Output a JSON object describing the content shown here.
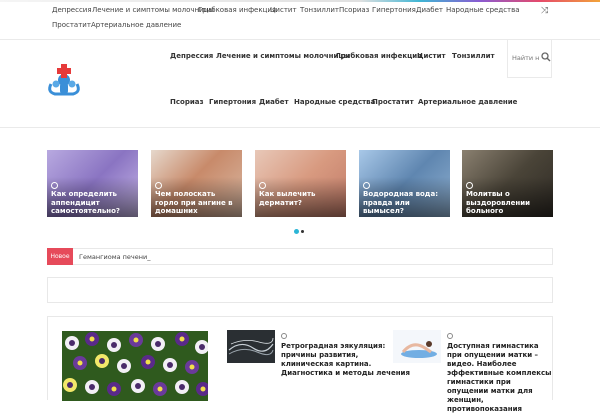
{
  "topbar": {
    "links": [
      "Депрессия",
      "Лечение и симптомы молочницы",
      "Грибковая инфекция",
      "Цистит",
      "Тонзиллит",
      "Псориаз",
      "Гипертония",
      "Диабет",
      "Народные средства",
      "Простатит",
      "Артериальное давление"
    ],
    "shuffle_icon": "shuffle-icon"
  },
  "nav": {
    "items": [
      "Депрессия",
      "Лечение и симптомы молочницы",
      "Грибковая инфекция",
      "Цистит",
      "Тонзиллит",
      "Псориаз",
      "Гипертония",
      "Диабет",
      "Народные средства",
      "Простатит",
      "Артериальное давление"
    ]
  },
  "search": {
    "placeholder": "Найти н"
  },
  "slider": {
    "slides": [
      {
        "title": "Как определить аппендицит самостоятельно?",
        "color": "#9a86c8"
      },
      {
        "title": "Чем полоскать горло при ангине в домашних условиях?",
        "color": "#c9a58a"
      },
      {
        "title": "Как вылечить дерматит?",
        "color": "#d8a088"
      },
      {
        "title": "Водородная вода: правда или вымысел?",
        "color": "#6f93b8"
      },
      {
        "title": "Молитвы о выздоровлении больного",
        "color": "#4a4438"
      }
    ],
    "dot_active_color": "#2bb5d6"
  },
  "ticker": {
    "badge": "Новое",
    "text": "Гемангиома печени_"
  },
  "posts": [
    {
      "title": "Ретроградная эякуляция: причины развития, клиническая картина. Диагностика и методы лечения"
    },
    {
      "title": "Доступная гимнастика при опущении матки – видео. Наиболее эффективные комплексы гимнастики при опущении матки для женщин, противопоказания"
    }
  ]
}
